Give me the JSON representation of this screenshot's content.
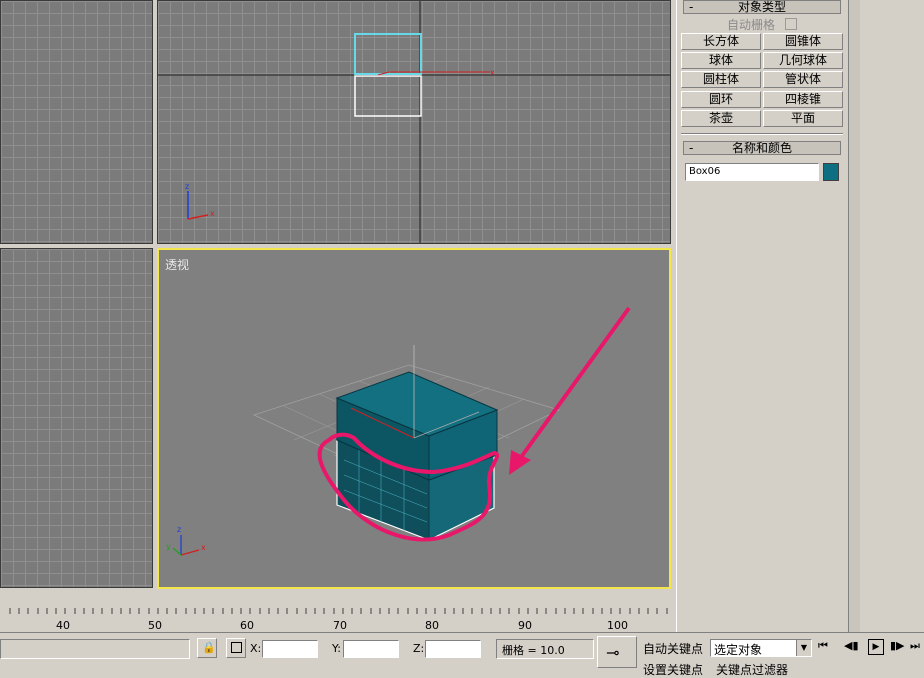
{
  "viewports": {
    "perspective_label": "透视",
    "axis_x": "x",
    "axis_y": "y",
    "axis_z": "z"
  },
  "panel": {
    "object_type_header": "对象类型",
    "collapse_symbol": "-",
    "autogrid_label": "自动栅格",
    "buttons": [
      "长方体",
      "圆锥体",
      "球体",
      "几何球体",
      "圆柱体",
      "管状体",
      "圆环",
      "四棱锥",
      "茶壶",
      "平面"
    ],
    "name_color_header": "名称和颜色",
    "object_name": "Box06",
    "object_color": "#0e6e82"
  },
  "ruler": {
    "ticks": [
      "40",
      "50",
      "60",
      "70",
      "80",
      "90",
      "100"
    ]
  },
  "status": {
    "x_label": "X:",
    "y_label": "Y:",
    "z_label": "Z:",
    "grid_text": "栅格 = 10.0",
    "auto_key": "自动关键点",
    "set_key": "设置关键点",
    "selection_value": "选定对象",
    "key_filter": "关键点过滤器"
  },
  "colors": {
    "selection_border": "#f2e64a",
    "annotation": "#e8176a",
    "box_teal": "#0e6e82"
  }
}
